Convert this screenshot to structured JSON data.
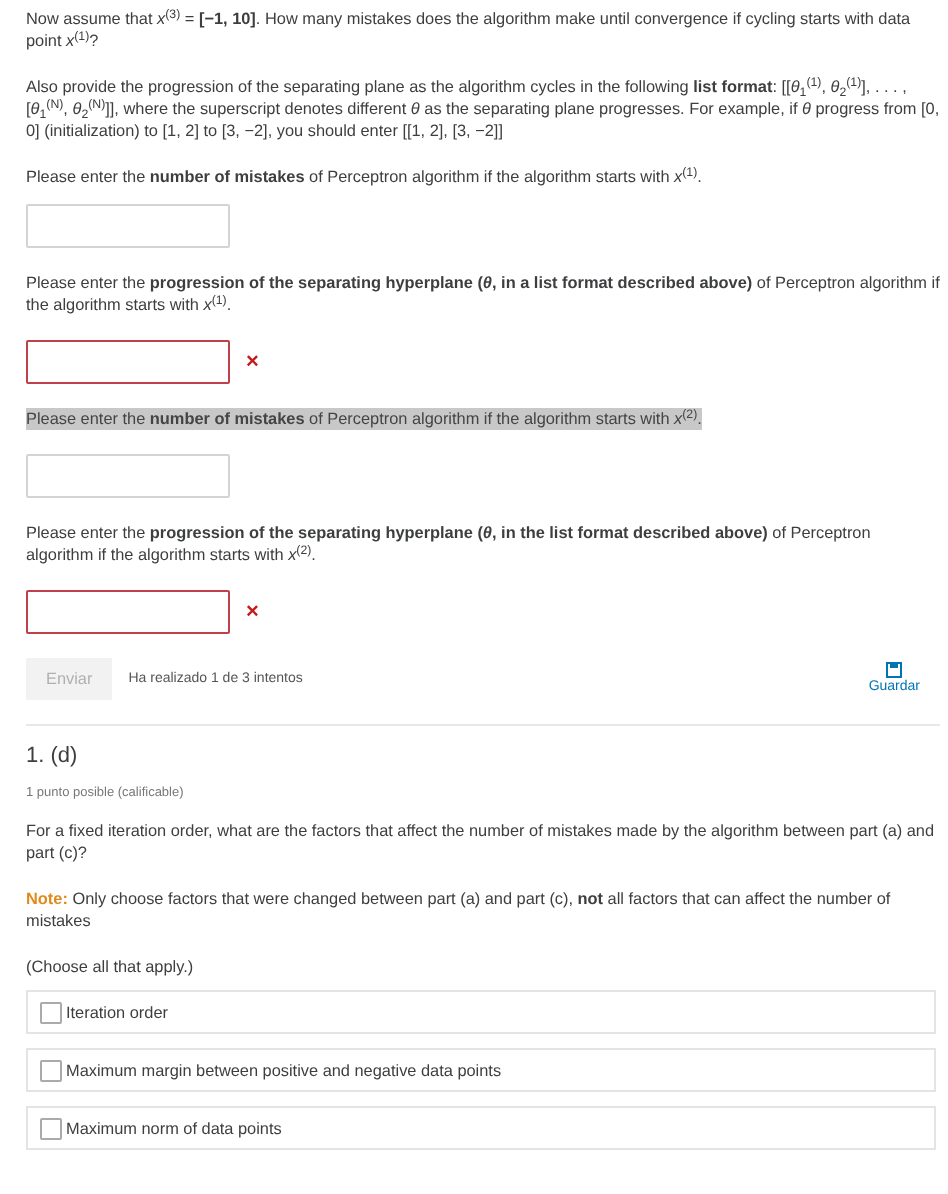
{
  "intro": [
    "Now assume that *x*$^{(3)}$ = **[−1, 10]**. How many mistakes does the algorithm make until convergence if cycling starts with data point *x*$^{(1)}$?",
    "Also provide the progression of the separating plane as the algorithm cycles in the following **list format**: [[*θ*$_{1}$$^{(1)}$, *θ*$_{2}$$^{(1)}$], . . . , [*θ*$_{1}$$^{(N)}$, *θ*$_{2}$$^{(N)}$]], where the superscript denotes different *θ* as the separating plane progresses. For example, if *θ* progress from [0, 0] (initialization) to [1, 2] to [3, −2], you should enter [[1, 2], [3, −2]]",
    "Please enter the **number of mistakes** of Perceptron algorithm if the algorithm starts with *x*$^{(1)}$."
  ],
  "questions": [
    {
      "error": false
    },
    {
      "prompt": "Please enter the **progression of the separating hyperplane (*θ*, in a list format described above)** of Perceptron algorithm if the algorithm starts with *x*$^{(1)}$.",
      "highlighted": false,
      "error": true,
      "mark": "×"
    },
    {
      "prompt": "Please enter the **number of mistakes** of Perceptron algorithm if the algorithm starts with *x*$^{(2)}$.",
      "highlighted": true,
      "error": false
    },
    {
      "prompt": "Please enter the **progression of the separating hyperplane (*θ*, in the list format described above)** of Perceptron algorithm if the algorithm starts with *x*$^{(2)}$.",
      "highlighted": false,
      "error": true,
      "mark": "×"
    }
  ],
  "submit": {
    "label": "Enviar",
    "disabled": true,
    "attempts": "Ha realizado 1 de 3 intentos",
    "save": "Guardar"
  },
  "section": {
    "title": "1. (d)",
    "points": "1 punto posible (calificable)",
    "question": "For a fixed iteration order, what are the factors that affect the number of mistakes made by the algorithm between part (a) and part (c)?",
    "note_label": "Note:",
    "note": "Only choose factors that were changed between part (a) and part (c), **not** all factors that can affect the number of mistakes",
    "instruction": "(Choose all that apply.)",
    "options": [
      {
        "label": "Iteration order",
        "checked": false
      },
      {
        "label": "Maximum margin between positive and negative data points",
        "checked": false
      },
      {
        "label": "Maximum norm of data points",
        "checked": false
      }
    ]
  }
}
